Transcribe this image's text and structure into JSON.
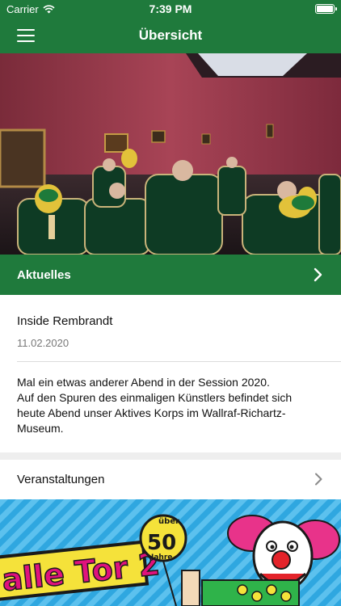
{
  "status_bar": {
    "carrier": "Carrier",
    "time": "7:39 PM"
  },
  "nav": {
    "title": "Übersicht",
    "menu_icon": "hamburger-menu-icon"
  },
  "colors": {
    "primary_green": "#1f7a3c",
    "separator_gray": "#eeeeee"
  },
  "news_section": {
    "label": "Aktuelles",
    "item": {
      "title": "Inside Rembrandt",
      "date": "11.02.2020",
      "text_lines": [
        "Mal ein etwas anderer Abend in der Session 2020.",
        "Auf den Spuren des einmaligen Künstlers befindet sich",
        "heute Abend unser Aktives Korps im Wallraf-Richartz-",
        "Museum."
      ]
    }
  },
  "events_row": {
    "label": "Veranstaltungen"
  },
  "banner": {
    "badge_top": "über",
    "badge_number": "50",
    "badge_bottom": "Jahre",
    "headline": "alle Tor 2"
  }
}
